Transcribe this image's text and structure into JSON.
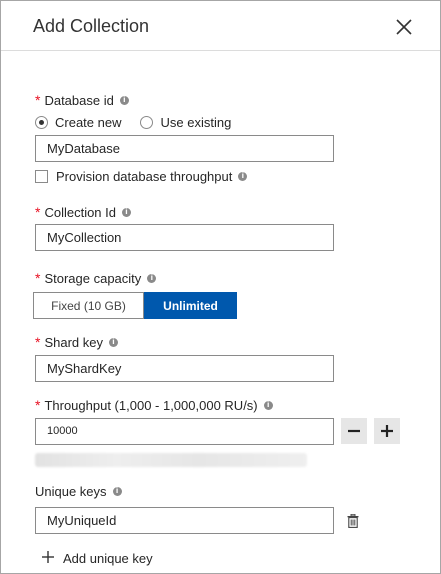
{
  "header": {
    "title": "Add Collection"
  },
  "database": {
    "label": "Database id",
    "options": [
      "Create new",
      "Use existing"
    ],
    "selected": "Create new",
    "value": "MyDatabase",
    "provision_label": "Provision database throughput",
    "provision_checked": false
  },
  "collection": {
    "label": "Collection Id",
    "value": "MyCollection"
  },
  "storage": {
    "label": "Storage capacity",
    "options": [
      "Fixed (10 GB)",
      "Unlimited"
    ],
    "selected": "Unlimited"
  },
  "shard": {
    "label": "Shard key",
    "value": "MyShardKey"
  },
  "throughput": {
    "label": "Throughput (1,000 - 1,000,000 RU/s)",
    "value": "10000"
  },
  "unique": {
    "label": "Unique keys",
    "value": "MyUniqueId",
    "add_label": "Add unique key"
  },
  "required_marker": "*",
  "info_glyph": "i",
  "colors": {
    "accent": "#0058ad",
    "required": "#e81123"
  },
  "icons": [
    "close-icon",
    "info-icon",
    "minus-icon",
    "plus-icon",
    "trash-icon",
    "add-icon"
  ]
}
